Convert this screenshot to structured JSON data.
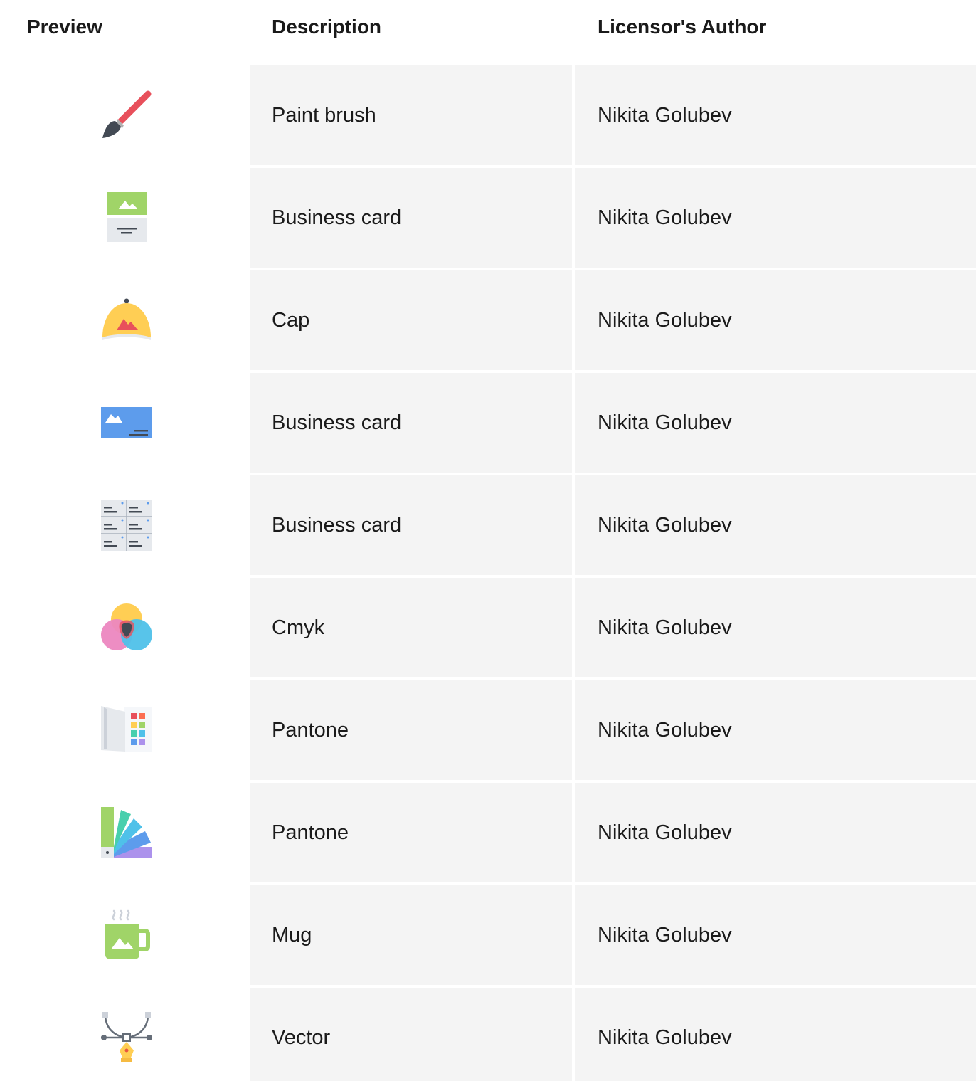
{
  "header": {
    "preview": "Preview",
    "description": "Description",
    "author": "Licensor's Author"
  },
  "rows": [
    {
      "icon": "paint-brush-icon",
      "description": "Paint brush",
      "author": "Nikita Golubev"
    },
    {
      "icon": "business-card-vertical-icon",
      "description": "Business card",
      "author": "Nikita Golubev"
    },
    {
      "icon": "cap-icon",
      "description": "Cap",
      "author": "Nikita Golubev"
    },
    {
      "icon": "business-card-blue-icon",
      "description": "Business card",
      "author": "Nikita Golubev"
    },
    {
      "icon": "business-card-sheet-icon",
      "description": "Business card",
      "author": "Nikita Golubev"
    },
    {
      "icon": "cmyk-icon",
      "description": "Cmyk",
      "author": "Nikita Golubev"
    },
    {
      "icon": "pantone-book-icon",
      "description": "Pantone",
      "author": "Nikita Golubev"
    },
    {
      "icon": "pantone-fan-icon",
      "description": "Pantone",
      "author": "Nikita Golubev"
    },
    {
      "icon": "mug-icon",
      "description": "Mug",
      "author": "Nikita Golubev"
    },
    {
      "icon": "vector-pen-icon",
      "description": "Vector",
      "author": "Nikita Golubev"
    }
  ]
}
